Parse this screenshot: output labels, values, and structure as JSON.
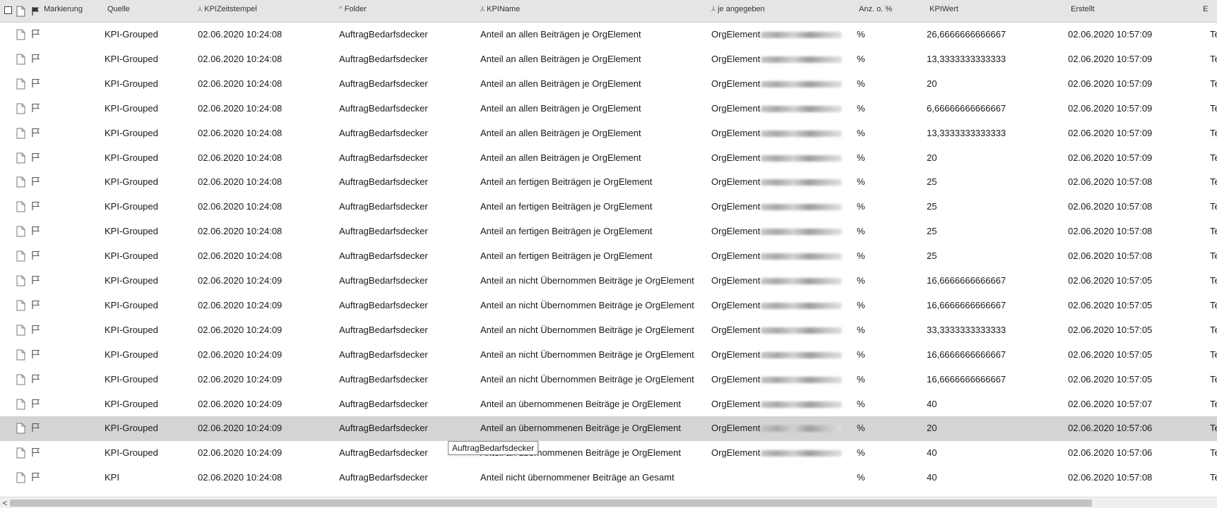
{
  "columns": [
    {
      "key": "markierung",
      "label": "Markierung",
      "left": 0
    },
    {
      "key": "quelle",
      "label": "Quelle"
    },
    {
      "key": "kpizeitstempel",
      "label": "KPIZeitstempel",
      "icon": "person-sort-icon"
    },
    {
      "key": "folder",
      "label": "Folder",
      "icon": "sort-up-icon"
    },
    {
      "key": "kpiname",
      "label": "KPIName",
      "icon": "person-sort-icon"
    },
    {
      "key": "je_angegeben",
      "label": "je angegeben",
      "icon": "person-sort-icon"
    },
    {
      "key": "anz_o_prozent",
      "label": "Anz. o. %"
    },
    {
      "key": "kpiwert",
      "label": "KPIWert"
    },
    {
      "key": "erstellt",
      "label": "Erstellt"
    },
    {
      "key": "next",
      "label": "E"
    }
  ],
  "rows": [
    {
      "quelle": "KPI-Grouped",
      "ts": "02.06.2020 10:24:08",
      "folder": "AuftragBedarfsdecker",
      "kpiname": "Anteil an allen Beiträgen je OrgElement",
      "je": "OrgElement",
      "blurred": true,
      "anz": "%",
      "wert": "26,6666666666667",
      "erstellt": "02.06.2020 10:57:09",
      "next": "Te"
    },
    {
      "quelle": "KPI-Grouped",
      "ts": "02.06.2020 10:24:08",
      "folder": "AuftragBedarfsdecker",
      "kpiname": "Anteil an allen Beiträgen je OrgElement",
      "je": "OrgElement",
      "blurred": true,
      "anz": "%",
      "wert": "13,3333333333333",
      "erstellt": "02.06.2020 10:57:09",
      "next": "Te"
    },
    {
      "quelle": "KPI-Grouped",
      "ts": "02.06.2020 10:24:08",
      "folder": "AuftragBedarfsdecker",
      "kpiname": "Anteil an allen Beiträgen je OrgElement",
      "je": "OrgElement",
      "blurred": true,
      "anz": "%",
      "wert": "20",
      "erstellt": "02.06.2020 10:57:09",
      "next": "Te"
    },
    {
      "quelle": "KPI-Grouped",
      "ts": "02.06.2020 10:24:08",
      "folder": "AuftragBedarfsdecker",
      "kpiname": "Anteil an allen Beiträgen je OrgElement",
      "je": "OrgElement",
      "blurred": true,
      "anz": "%",
      "wert": "6,66666666666667",
      "erstellt": "02.06.2020 10:57:09",
      "next": "Te"
    },
    {
      "quelle": "KPI-Grouped",
      "ts": "02.06.2020 10:24:08",
      "folder": "AuftragBedarfsdecker",
      "kpiname": "Anteil an allen Beiträgen je OrgElement",
      "je": "OrgElement",
      "blurred": true,
      "anz": "%",
      "wert": "13,3333333333333",
      "erstellt": "02.06.2020 10:57:09",
      "next": "Te"
    },
    {
      "quelle": "KPI-Grouped",
      "ts": "02.06.2020 10:24:08",
      "folder": "AuftragBedarfsdecker",
      "kpiname": "Anteil an allen Beiträgen je OrgElement",
      "je": "OrgElement",
      "blurred": true,
      "anz": "%",
      "wert": "20",
      "erstellt": "02.06.2020 10:57:09",
      "next": "Te"
    },
    {
      "quelle": "KPI-Grouped",
      "ts": "02.06.2020 10:24:08",
      "folder": "AuftragBedarfsdecker",
      "kpiname": "Anteil an fertigen Beiträgen je OrgElement",
      "je": "OrgElement",
      "blurred": true,
      "anz": "%",
      "wert": "25",
      "erstellt": "02.06.2020 10:57:08",
      "next": "Te"
    },
    {
      "quelle": "KPI-Grouped",
      "ts": "02.06.2020 10:24:08",
      "folder": "AuftragBedarfsdecker",
      "kpiname": "Anteil an fertigen Beiträgen je OrgElement",
      "je": "OrgElement",
      "blurred": true,
      "anz": "%",
      "wert": "25",
      "erstellt": "02.06.2020 10:57:08",
      "next": "Te"
    },
    {
      "quelle": "KPI-Grouped",
      "ts": "02.06.2020 10:24:08",
      "folder": "AuftragBedarfsdecker",
      "kpiname": "Anteil an fertigen Beiträgen je OrgElement",
      "je": "OrgElement",
      "blurred": true,
      "anz": "%",
      "wert": "25",
      "erstellt": "02.06.2020 10:57:08",
      "next": "Te"
    },
    {
      "quelle": "KPI-Grouped",
      "ts": "02.06.2020 10:24:08",
      "folder": "AuftragBedarfsdecker",
      "kpiname": "Anteil an fertigen Beiträgen je OrgElement",
      "je": "OrgElement",
      "blurred": true,
      "anz": "%",
      "wert": "25",
      "erstellt": "02.06.2020 10:57:08",
      "next": "Te"
    },
    {
      "quelle": "KPI-Grouped",
      "ts": "02.06.2020 10:24:09",
      "folder": "AuftragBedarfsdecker",
      "kpiname": "Anteil an nicht Übernommen Beiträge je OrgElement",
      "je": "OrgElement",
      "blurred": true,
      "anz": "%",
      "wert": "16,6666666666667",
      "erstellt": "02.06.2020 10:57:05",
      "next": "Te"
    },
    {
      "quelle": "KPI-Grouped",
      "ts": "02.06.2020 10:24:09",
      "folder": "AuftragBedarfsdecker",
      "kpiname": "Anteil an nicht Übernommen Beiträge je OrgElement",
      "je": "OrgElement",
      "blurred": true,
      "anz": "%",
      "wert": "16,6666666666667",
      "erstellt": "02.06.2020 10:57:05",
      "next": "Te"
    },
    {
      "quelle": "KPI-Grouped",
      "ts": "02.06.2020 10:24:09",
      "folder": "AuftragBedarfsdecker",
      "kpiname": "Anteil an nicht Übernommen Beiträge je OrgElement",
      "je": "OrgElement",
      "blurred": true,
      "anz": "%",
      "wert": "33,3333333333333",
      "erstellt": "02.06.2020 10:57:05",
      "next": "Te"
    },
    {
      "quelle": "KPI-Grouped",
      "ts": "02.06.2020 10:24:09",
      "folder": "AuftragBedarfsdecker",
      "kpiname": "Anteil an nicht Übernommen Beiträge je OrgElement",
      "je": "OrgElement",
      "blurred": true,
      "anz": "%",
      "wert": "16,6666666666667",
      "erstellt": "02.06.2020 10:57:05",
      "next": "Te"
    },
    {
      "quelle": "KPI-Grouped",
      "ts": "02.06.2020 10:24:09",
      "folder": "AuftragBedarfsdecker",
      "kpiname": "Anteil an nicht Übernommen Beiträge je OrgElement",
      "je": "OrgElement",
      "blurred": true,
      "anz": "%",
      "wert": "16,6666666666667",
      "erstellt": "02.06.2020 10:57:05",
      "next": "Te"
    },
    {
      "quelle": "KPI-Grouped",
      "ts": "02.06.2020 10:24:09",
      "folder": "AuftragBedarfsdecker",
      "kpiname": "Anteil an übernommenen Beiträge je OrgElement",
      "je": "OrgElement",
      "blurred": true,
      "anz": "%",
      "wert": "40",
      "erstellt": "02.06.2020 10:57:07",
      "next": "Te"
    },
    {
      "quelle": "KPI-Grouped",
      "ts": "02.06.2020 10:24:09",
      "folder": "AuftragBedarfsdecker",
      "kpiname": "Anteil an übernommenen Beiträge je OrgElement",
      "je": "OrgElement",
      "blurred": true,
      "anz": "%",
      "wert": "20",
      "erstellt": "02.06.2020 10:57:06",
      "next": "Te",
      "selected": true
    },
    {
      "quelle": "KPI-Grouped",
      "ts": "02.06.2020 10:24:09",
      "folder": "AuftragBedarfsdecker",
      "kpiname": "Anteil an übernommenen Beiträge je OrgElement",
      "je": "OrgElement",
      "blurred": true,
      "anz": "%",
      "wert": "40",
      "erstellt": "02.06.2020 10:57:06",
      "next": "Te"
    },
    {
      "quelle": "KPI",
      "ts": "02.06.2020 10:24:08",
      "folder": "AuftragBedarfsdecker",
      "kpiname": "Anteil nicht übernommener Beiträge an Gesamt",
      "je": "",
      "blurred": false,
      "anz": "%",
      "wert": "40",
      "erstellt": "02.06.2020 10:57:08",
      "next": "Te"
    }
  ],
  "tooltip": {
    "text": "AuftragBedarfsdecker"
  },
  "scrollbar": {
    "left_arrow": "<"
  },
  "icons": {
    "document": "document-icon",
    "flag": "flag-icon",
    "checkbox": "checkbox"
  },
  "colors": {
    "header_bg": "#e5e5e5",
    "selected_row_bg": "#d4d4d4",
    "scroll_thumb": "#c2c2c2"
  }
}
